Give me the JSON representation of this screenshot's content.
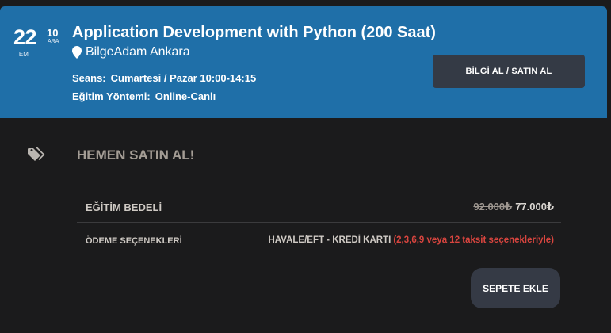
{
  "header": {
    "date": {
      "day": "22",
      "month": "TEM",
      "end_day": "10",
      "end_month": "ARA"
    },
    "title": "Application Development with Python (200 Saat)",
    "location": "BilgeAdam Ankara",
    "session_label": "Seans:",
    "session_value": "Cumartesi / Pazar 10:00-14:15",
    "method_label": "Eğitim Yöntemi:",
    "method_value": "Online-Canlı",
    "info_button": "BİLGİ AL / SATIN AL",
    "bg_color": "#1f6fa8"
  },
  "purchase": {
    "heading": "HEMEN SATIN AL!",
    "price_label": "EĞİTİM BEDELİ",
    "old_price": "92.000₺",
    "new_price": "77.000₺",
    "payment_label": "ÖDEME SEÇENEKLERİ",
    "payment_methods": "HAVALE/EFT - KREDİ KARTI",
    "installments": "(2,3,6,9 veya 12 taksit seçenekleriyle)",
    "cart_button": "SEPETE EKLE",
    "accent_red": "#d9453f"
  },
  "icons": {
    "location": "map-pin-icon",
    "tag": "tags-icon"
  }
}
